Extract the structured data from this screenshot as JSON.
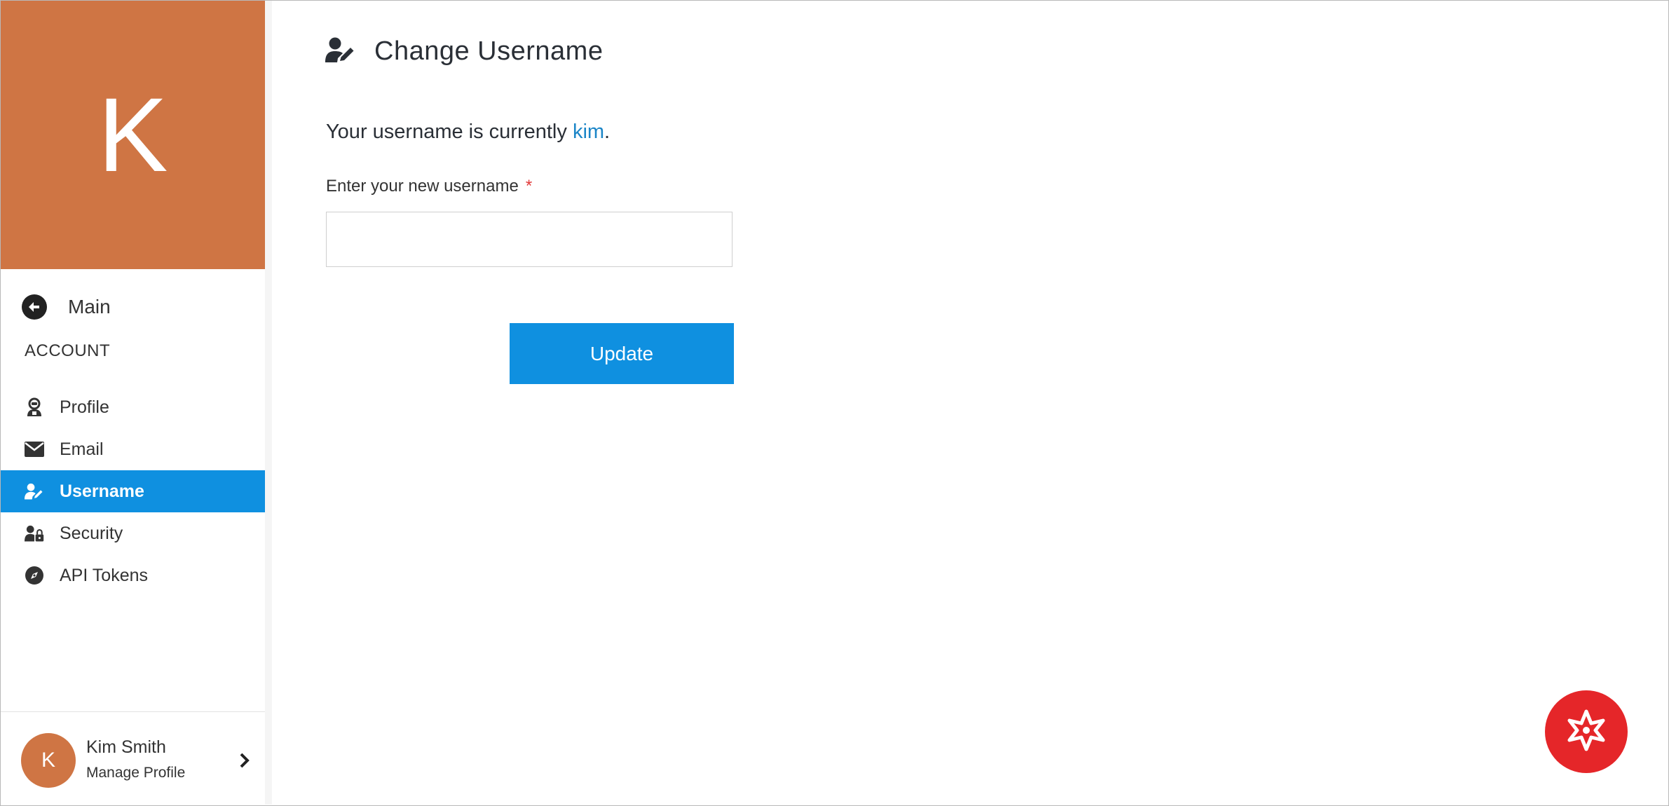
{
  "sidebar": {
    "hero_initial": "K",
    "main_label": "Main",
    "section_title": "ACCOUNT",
    "items": [
      {
        "label": "Profile",
        "icon": "user-robot-icon"
      },
      {
        "label": "Email",
        "icon": "envelope-icon"
      },
      {
        "label": "Username",
        "icon": "user-edit-icon",
        "active": true
      },
      {
        "label": "Security",
        "icon": "user-lock-icon"
      },
      {
        "label": "API Tokens",
        "icon": "compass-icon"
      }
    ],
    "footer": {
      "initial": "K",
      "name": "Kim Smith",
      "subtitle": "Manage Profile"
    }
  },
  "main": {
    "title": "Change Username",
    "current_prefix": "Your username is currently ",
    "current_username": "kim",
    "current_suffix": ".",
    "field_label": "Enter your new username",
    "required_mark": "*",
    "input_value": "",
    "button_label": "Update"
  },
  "colors": {
    "accent": "#0f90e0",
    "avatar": "#cf7544",
    "fab": "#e52629",
    "link": "#1b85c7"
  }
}
